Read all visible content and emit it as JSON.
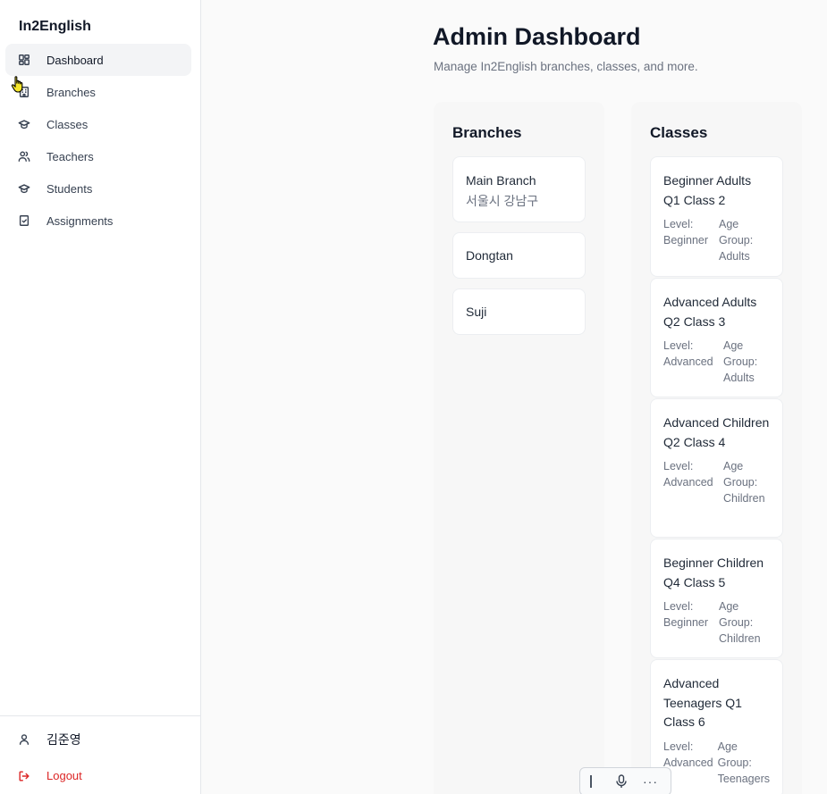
{
  "app": {
    "brand": "In2English"
  },
  "sidebar": {
    "items": [
      {
        "label": "Dashboard",
        "icon": "dashboard-icon",
        "active": true
      },
      {
        "label": "Branches",
        "icon": "building-icon"
      },
      {
        "label": "Classes",
        "icon": "graduation-cap-icon"
      },
      {
        "label": "Teachers",
        "icon": "users-icon"
      },
      {
        "label": "Students",
        "icon": "graduation-cap-icon"
      },
      {
        "label": "Assignments",
        "icon": "clipboard-check-icon"
      }
    ],
    "user": {
      "name": "김준영",
      "icon": "user-icon"
    },
    "logout": {
      "label": "Logout",
      "icon": "logout-icon",
      "color": "#dc2626"
    }
  },
  "main": {
    "title": "Admin Dashboard",
    "subtitle": "Manage In2English branches, classes, and more."
  },
  "branches": {
    "title": "Branches",
    "items": [
      {
        "name": "Main Branch",
        "address": "서울시 강남구"
      },
      {
        "name": "Dongtan"
      },
      {
        "name": "Suji"
      }
    ]
  },
  "classes": {
    "title": "Classes",
    "items": [
      {
        "name": "Beginner Adults Q1 Class 2",
        "level_label": "Level:",
        "level": "Beginner",
        "age_label": "Age Group:",
        "age": "Adults"
      },
      {
        "name": "Advanced Adults Q2 Class 3",
        "level_label": "Level:",
        "level": "Advanced",
        "age_label": "Age Group:",
        "age": "Adults"
      },
      {
        "name": "Advanced Children Q2 Class 4",
        "level_label": "Level:",
        "level": "Advanced",
        "age_label": "Age Group:",
        "age": "Children"
      },
      {
        "name": "Beginner Children Q4 Class 5",
        "level_label": "Level:",
        "level": "Beginner",
        "age_label": "Age Group:",
        "age": "Children"
      },
      {
        "name": "Advanced Teenagers Q1 Class 6",
        "level_label": "Level:",
        "level": "Advanced",
        "age_label": "Age Group:",
        "age": "Teenagers"
      }
    ]
  },
  "voice_toolbar": {
    "more_label": "···",
    "icons": [
      "grip-handle-icon",
      "microphone-icon",
      "more-icon"
    ]
  },
  "colors": {
    "accent_danger": "#dc2626",
    "sidebar_active_bg": "#f3f4f6",
    "page_bg": "#fafafa"
  }
}
